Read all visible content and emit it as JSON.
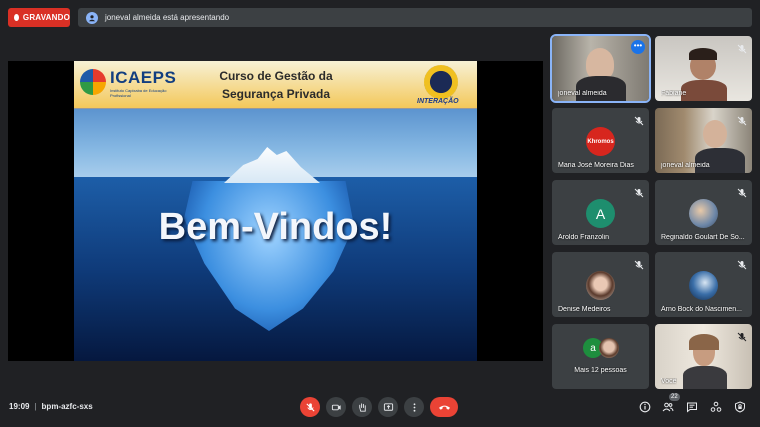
{
  "top": {
    "recording_label": "GRAVANDO",
    "presenting_text": "joneval almeida está apresentando"
  },
  "slide": {
    "org_name": "ICAEPS",
    "org_subtitle": "Instituto Capixaba de Educação Profissional",
    "course_title_line1": "Curso de Gestão da",
    "course_title_line2": "Segurança Privada",
    "seal_text": "INTERAÇÃO",
    "welcome_text": "Bem-Vindos!"
  },
  "participants": [
    {
      "name": "joneval almeida",
      "type": "video"
    },
    {
      "name": "Fabiane",
      "type": "video"
    },
    {
      "name": "Maria José Moreira Dias",
      "type": "logo",
      "logo_text": "Khromos"
    },
    {
      "name": "joneval almeida",
      "type": "video"
    },
    {
      "name": "Aroldo Franzolin",
      "type": "avatar",
      "initial": "A",
      "color": "#1e8e6e"
    },
    {
      "name": "Reginaldo Goulart De So...",
      "type": "photo"
    },
    {
      "name": "Denise Medeiros",
      "type": "photo"
    },
    {
      "name": "Arno Bock do Nascimen...",
      "type": "photo"
    },
    {
      "name": "Mais 12 pessoas",
      "type": "more",
      "initial": "a",
      "color": "#1e8e3e"
    },
    {
      "name": "Você",
      "type": "video"
    }
  ],
  "bottom": {
    "time": "19:09",
    "meeting_code": "bpm-azfc-sxs",
    "people_count": "22"
  },
  "colors": {
    "recording": "#d93025",
    "hangup": "#ea4335",
    "active_border": "#8ab4f8"
  }
}
